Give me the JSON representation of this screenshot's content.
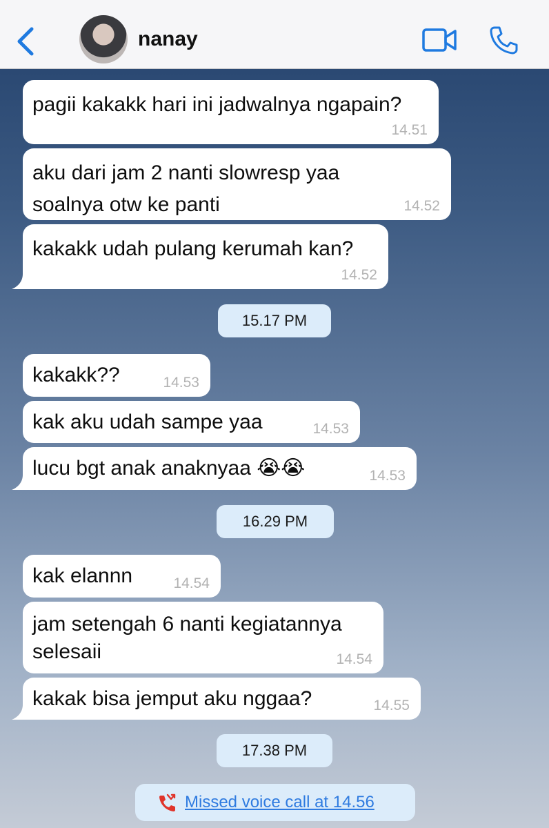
{
  "header": {
    "contact_name": "nanay",
    "back_icon": "chevron-left-icon",
    "video_icon": "video-camera-icon",
    "call_icon": "phone-icon",
    "accent_color": "#1f7ae0"
  },
  "messages": [
    {
      "text": "pagii kakakk hari ini jadwalnya ngapain?",
      "time": "14.51"
    },
    {
      "text": "aku dari jam 2 nanti slowresp yaa\nsoalnya otw ke panti",
      "time": "14.52"
    },
    {
      "text": "kakakk udah pulang kerumah kan?",
      "time": "14.52"
    },
    {
      "text": "kakakk??",
      "time": "14.53"
    },
    {
      "text": "kak aku udah sampe yaa",
      "time": "14.53"
    },
    {
      "text": "lucu bgt anak anaknyaa 😭😭",
      "time": "14.53"
    },
    {
      "text": "kak elannn",
      "time": "14.54"
    },
    {
      "text": "jam setengah 6 nanti kegiatannya\nselesaii",
      "time": "14.54"
    },
    {
      "text": "kakak bisa jemput aku nggaa?",
      "time": "14.55"
    }
  ],
  "date_separators": [
    "15.17 PM",
    "16.29 PM",
    "17.38 PM"
  ],
  "missed_call": {
    "label": "Missed voice call at 14.56",
    "icon": "missed-call-icon",
    "icon_color": "#e0342b"
  }
}
